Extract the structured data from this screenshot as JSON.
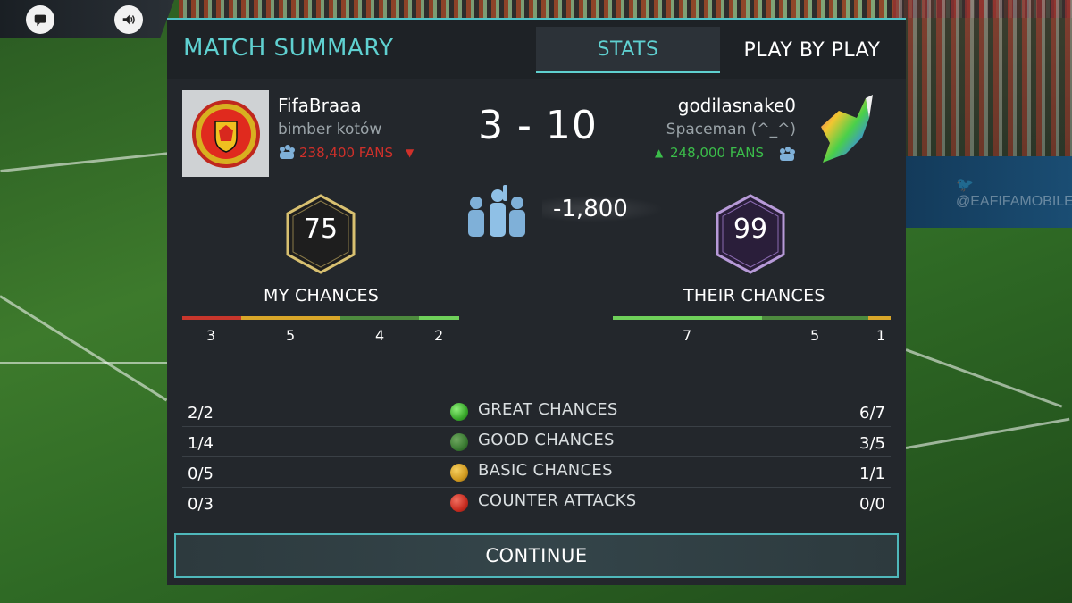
{
  "header": {
    "title": "MATCH SUMMARY",
    "tabs": [
      {
        "label": "STATS",
        "active": true
      },
      {
        "label": "PLAY BY PLAY",
        "active": false
      }
    ]
  },
  "home": {
    "name": "FifaBraaa",
    "club": "bimber kotów",
    "fans": "238,400 FANS",
    "fans_trend": "down",
    "rating": "75",
    "crest": "manchester-united-crest"
  },
  "away": {
    "name": "godilasnake0",
    "club": "Spaceman (^_^)",
    "fans": "248,000 FANS",
    "fans_trend": "up",
    "rating": "99",
    "crest": "unicorn-crest"
  },
  "score": "3 - 10",
  "fan_change": "-1,800",
  "my_chances": {
    "label": "MY CHANCES",
    "values": [
      "3",
      "5",
      "4",
      "2"
    ]
  },
  "their_chances": {
    "label": "THEIR CHANCES",
    "values": [
      "7",
      "5",
      "1"
    ]
  },
  "stats": [
    {
      "left": "2/2",
      "label": "GREAT CHANCES",
      "right": "6/7",
      "color": "#4ec23a"
    },
    {
      "left": "1/4",
      "label": "GOOD CHANCES",
      "right": "3/5",
      "color": "#3f8a3a"
    },
    {
      "left": "0/5",
      "label": "BASIC CHANCES",
      "right": "1/1",
      "color": "#d9a629"
    },
    {
      "left": "0/3",
      "label": "COUNTER ATTACKS",
      "right": "0/0",
      "color": "#d03428"
    }
  ],
  "continue_label": "CONTINUE",
  "colors": {
    "accent": "#5fd0d0",
    "panel": "#23272c",
    "fans_down": "#d0302a",
    "fans_up": "#3bbd4a"
  }
}
